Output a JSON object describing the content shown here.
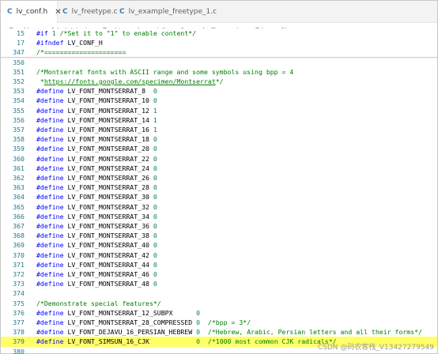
{
  "tabs": [
    {
      "icon": "C",
      "label": "lv_conf.h",
      "close": "✕"
    },
    {
      "icon": "C",
      "label": "lv_freetype.c"
    },
    {
      "icon": "C",
      "label": "lv_example_freetype_1.c"
    }
  ],
  "breadcrumb": [
    "C:",
    "Users",
    "Administrator",
    "Desktop",
    "lv_port_linux_frame_buffer-master",
    "C  lv_conf.h",
    "..."
  ],
  "lines": [
    {
      "n": "15",
      "segs": [
        [
          "kw",
          "#if "
        ],
        [
          "nm",
          "1"
        ],
        [
          "cm",
          " /*Set it to \"1\" to enable content*/"
        ]
      ]
    },
    {
      "n": "17",
      "segs": [
        [
          "kw",
          "#ifndef "
        ],
        [
          "",
          "LV_CONF_H"
        ]
      ]
    },
    {
      "n": "347",
      "segs": [
        [
          "cm",
          "/*====================="
        ]
      ]
    },
    {
      "n": "350",
      "segs": []
    },
    {
      "n": "351",
      "segs": [
        [
          "cm",
          "/*Montserrat fonts with ASCII range and some symbols using bpp = 4"
        ]
      ]
    },
    {
      "n": "352",
      "segs": [
        [
          "cm",
          " *"
        ],
        [
          "cm lnk",
          "https://fonts.google.com/specimen/Montserrat"
        ],
        [
          "cm",
          "*/"
        ]
      ]
    },
    {
      "n": "353",
      "segs": [
        [
          "kw",
          "#define "
        ],
        [
          "",
          "LV_FONT_MONTSERRAT_8  "
        ],
        [
          "nm",
          "0"
        ]
      ]
    },
    {
      "n": "354",
      "segs": [
        [
          "kw",
          "#define "
        ],
        [
          "",
          "LV_FONT_MONTSERRAT_10 "
        ],
        [
          "nm",
          "0"
        ]
      ]
    },
    {
      "n": "355",
      "segs": [
        [
          "kw",
          "#define "
        ],
        [
          "",
          "LV_FONT_MONTSERRAT_12 "
        ],
        [
          "nm",
          "1"
        ]
      ]
    },
    {
      "n": "356",
      "segs": [
        [
          "kw",
          "#define "
        ],
        [
          "",
          "LV_FONT_MONTSERRAT_14 "
        ],
        [
          "nm",
          "1"
        ]
      ]
    },
    {
      "n": "357",
      "segs": [
        [
          "kw",
          "#define "
        ],
        [
          "",
          "LV_FONT_MONTSERRAT_16 "
        ],
        [
          "nm",
          "1"
        ]
      ]
    },
    {
      "n": "358",
      "segs": [
        [
          "kw",
          "#define "
        ],
        [
          "",
          "LV_FONT_MONTSERRAT_18 "
        ],
        [
          "nm",
          "0"
        ]
      ]
    },
    {
      "n": "359",
      "segs": [
        [
          "kw",
          "#define "
        ],
        [
          "",
          "LV_FONT_MONTSERRAT_20 "
        ],
        [
          "nm",
          "0"
        ]
      ]
    },
    {
      "n": "360",
      "segs": [
        [
          "kw",
          "#define "
        ],
        [
          "",
          "LV_FONT_MONTSERRAT_22 "
        ],
        [
          "nm",
          "0"
        ]
      ]
    },
    {
      "n": "361",
      "segs": [
        [
          "kw",
          "#define "
        ],
        [
          "",
          "LV_FONT_MONTSERRAT_24 "
        ],
        [
          "nm",
          "0"
        ]
      ]
    },
    {
      "n": "362",
      "segs": [
        [
          "kw",
          "#define "
        ],
        [
          "",
          "LV_FONT_MONTSERRAT_26 "
        ],
        [
          "nm",
          "0"
        ]
      ]
    },
    {
      "n": "363",
      "segs": [
        [
          "kw",
          "#define "
        ],
        [
          "",
          "LV_FONT_MONTSERRAT_28 "
        ],
        [
          "nm",
          "0"
        ]
      ]
    },
    {
      "n": "364",
      "segs": [
        [
          "kw",
          "#define "
        ],
        [
          "",
          "LV_FONT_MONTSERRAT_30 "
        ],
        [
          "nm",
          "0"
        ]
      ]
    },
    {
      "n": "365",
      "segs": [
        [
          "kw",
          "#define "
        ],
        [
          "",
          "LV_FONT_MONTSERRAT_32 "
        ],
        [
          "nm",
          "0"
        ]
      ]
    },
    {
      "n": "366",
      "segs": [
        [
          "kw",
          "#define "
        ],
        [
          "",
          "LV_FONT_MONTSERRAT_34 "
        ],
        [
          "nm",
          "0"
        ]
      ]
    },
    {
      "n": "367",
      "segs": [
        [
          "kw",
          "#define "
        ],
        [
          "",
          "LV_FONT_MONTSERRAT_36 "
        ],
        [
          "nm",
          "0"
        ]
      ]
    },
    {
      "n": "368",
      "segs": [
        [
          "kw",
          "#define "
        ],
        [
          "",
          "LV_FONT_MONTSERRAT_38 "
        ],
        [
          "nm",
          "0"
        ]
      ]
    },
    {
      "n": "369",
      "segs": [
        [
          "kw",
          "#define "
        ],
        [
          "",
          "LV_FONT_MONTSERRAT_40 "
        ],
        [
          "nm",
          "0"
        ]
      ]
    },
    {
      "n": "370",
      "segs": [
        [
          "kw",
          "#define "
        ],
        [
          "",
          "LV_FONT_MONTSERRAT_42 "
        ],
        [
          "nm",
          "0"
        ]
      ]
    },
    {
      "n": "371",
      "segs": [
        [
          "kw",
          "#define "
        ],
        [
          "",
          "LV_FONT_MONTSERRAT_44 "
        ],
        [
          "nm",
          "0"
        ]
      ]
    },
    {
      "n": "372",
      "segs": [
        [
          "kw",
          "#define "
        ],
        [
          "",
          "LV_FONT_MONTSERRAT_46 "
        ],
        [
          "nm",
          "0"
        ]
      ]
    },
    {
      "n": "373",
      "segs": [
        [
          "kw",
          "#define "
        ],
        [
          "",
          "LV_FONT_MONTSERRAT_48 "
        ],
        [
          "nm",
          "0"
        ]
      ]
    },
    {
      "n": "374",
      "segs": []
    },
    {
      "n": "375",
      "segs": [
        [
          "cm",
          "/*Demonstrate special features*/"
        ]
      ]
    },
    {
      "n": "376",
      "segs": [
        [
          "kw",
          "#define "
        ],
        [
          "",
          "LV_FONT_MONTSERRAT_12_SUBPX      "
        ],
        [
          "nm",
          "0"
        ]
      ]
    },
    {
      "n": "377",
      "segs": [
        [
          "kw",
          "#define "
        ],
        [
          "",
          "LV_FONT_MONTSERRAT_28_COMPRESSED "
        ],
        [
          "nm",
          "0"
        ],
        [
          "cm",
          "  /*bpp = 3*/"
        ]
      ]
    },
    {
      "n": "378",
      "segs": [
        [
          "kw",
          "#define "
        ],
        [
          "",
          "LV_FONT_DEJAVU_16_PERSIAN_HEBREW "
        ],
        [
          "nm",
          "0"
        ],
        [
          "cm",
          "  /*Hebrew, Arabic, Persian letters and all their forms*/"
        ]
      ]
    },
    {
      "n": "379",
      "segs": [
        [
          "kw",
          "#define "
        ],
        [
          "",
          "LV_FONT_SIMSUN_16_CJK            "
        ],
        [
          "nm",
          "0"
        ],
        [
          "cm",
          "  /*1000 most common CJK radicals*/"
        ]
      ],
      "highlight": true
    },
    {
      "n": "380",
      "segs": []
    }
  ],
  "watermark": "CSDN @码农客栈_V13427279549",
  "colors": {
    "keyword": "#0000ff",
    "comment": "#008000",
    "number": "#098658",
    "line_number": "#237893",
    "highlight": "#ffff66"
  }
}
